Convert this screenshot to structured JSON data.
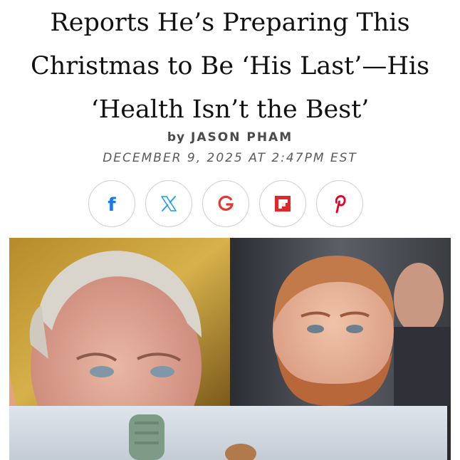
{
  "article": {
    "headline_lines": [
      "Reports He’s Preparing This",
      "Christmas to Be ‘His Last’—His",
      "‘Health Isn’t the Best’"
    ],
    "byline_prefix": "by",
    "author": "JASON PHAM",
    "dateline": "DECEMBER 9, 2025 AT 2:47PM EST"
  },
  "share": {
    "buttons": [
      {
        "icon": "facebook-icon",
        "color": "#1877f2"
      },
      {
        "icon": "x-icon",
        "color": "#1d9bf0"
      },
      {
        "icon": "google-icon",
        "color": "#e8362c"
      },
      {
        "icon": "flipboard-icon",
        "color": "#e12828"
      },
      {
        "icon": "pinterest-icon",
        "color": "#e60023"
      }
    ]
  },
  "hero": {
    "panels": [
      "left-portrait",
      "right-portrait",
      "bottom-photo"
    ]
  }
}
